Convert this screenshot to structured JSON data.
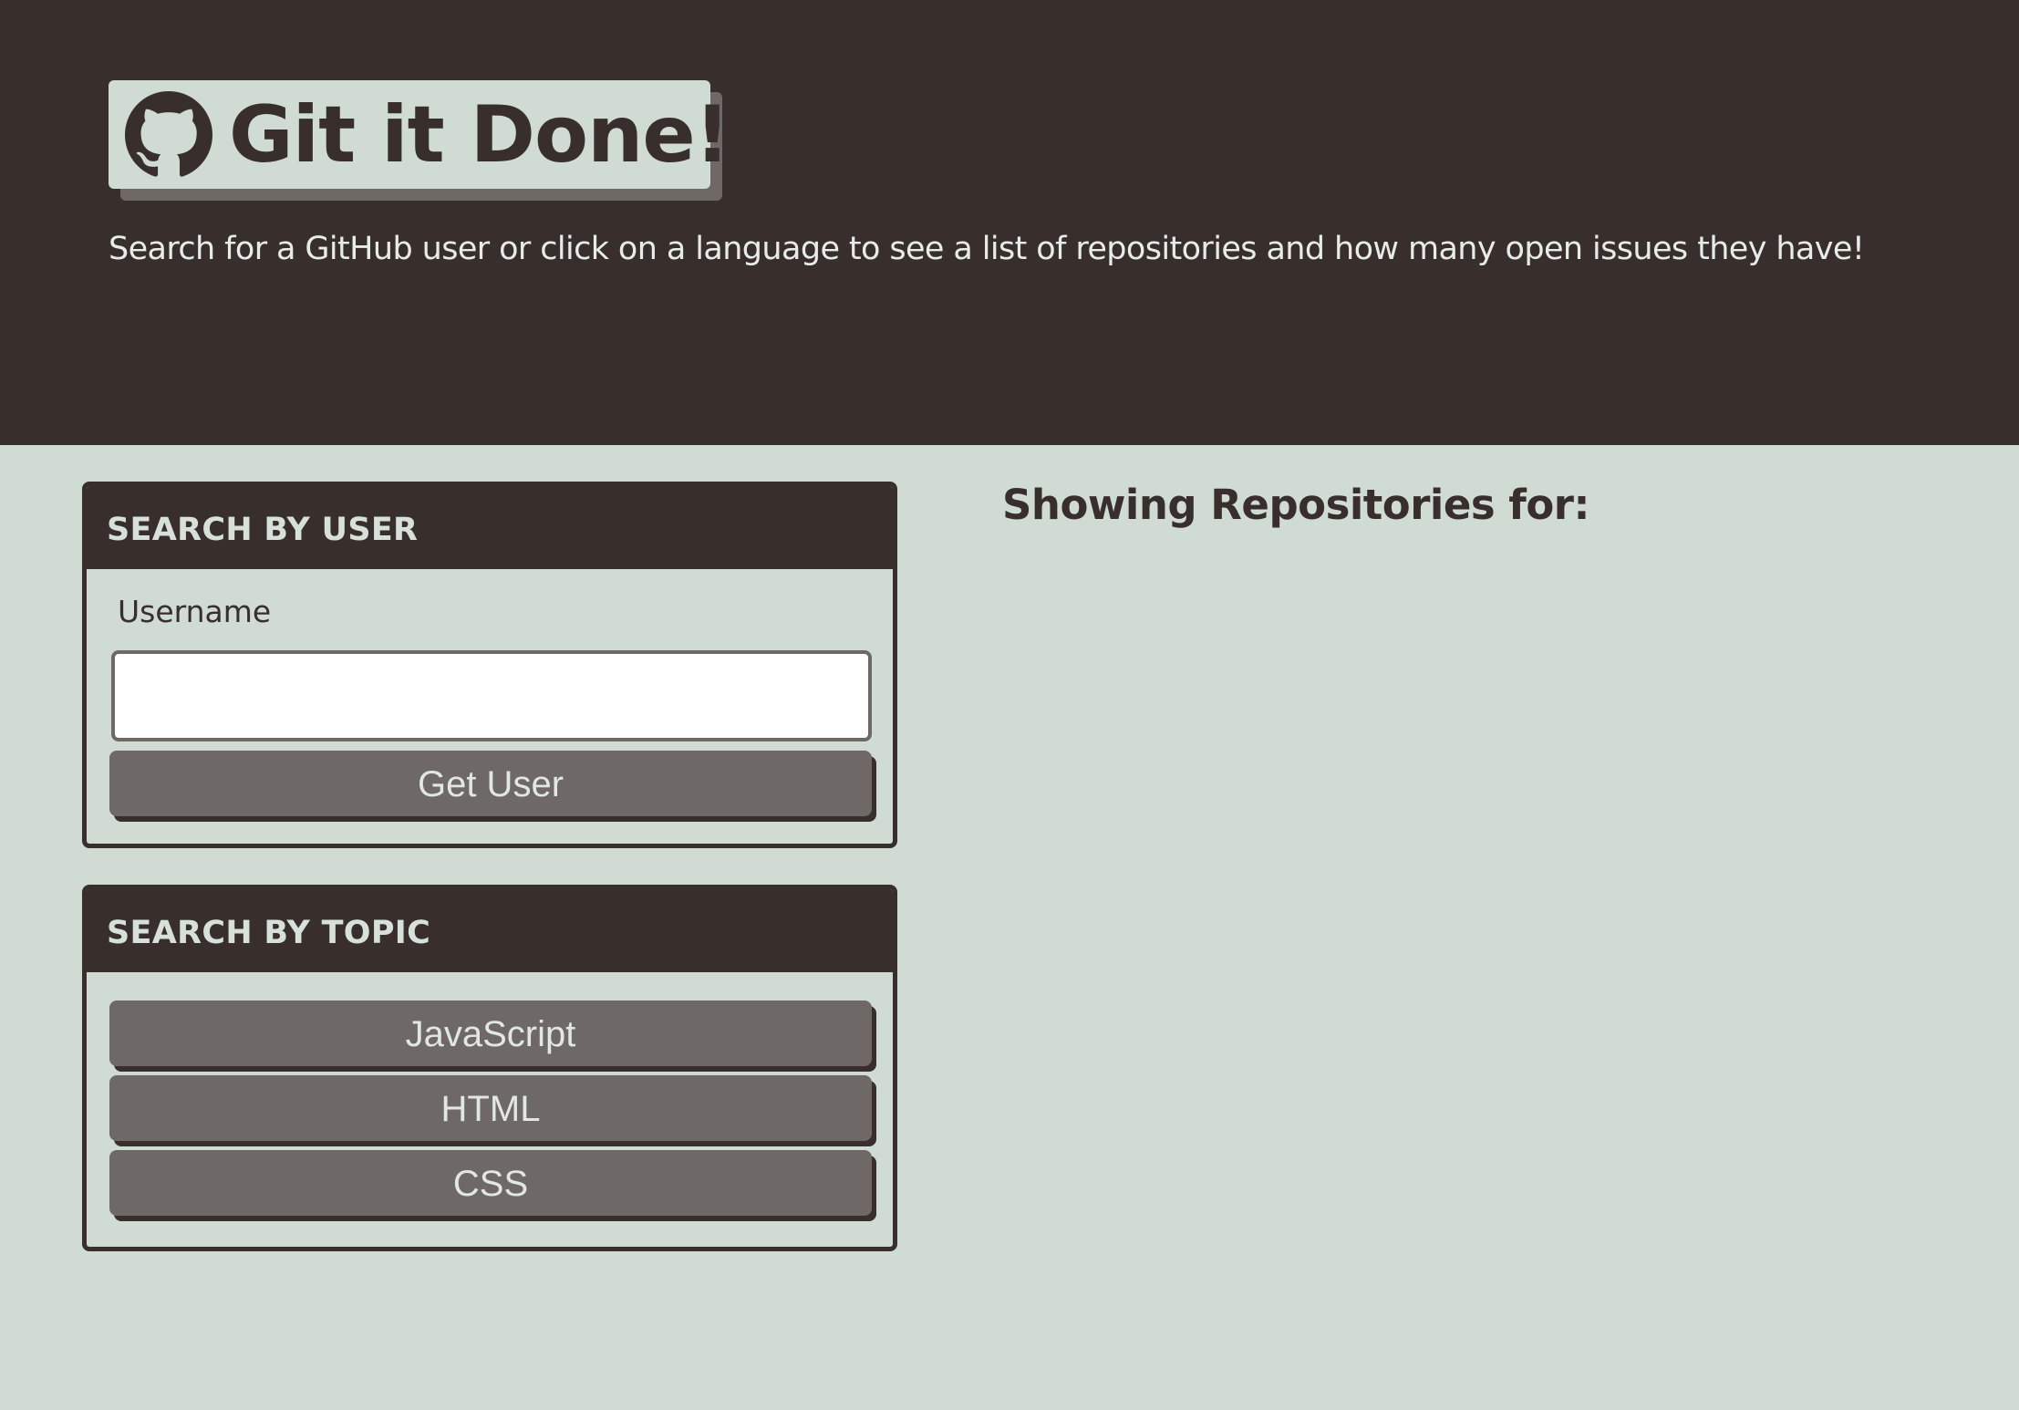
{
  "header": {
    "title": "Git it Done!",
    "subtitle": "Search for a GitHub user or click on a language to see a list of repositories and how many open issues they have!",
    "logo_icon": "github-octocat-icon"
  },
  "user_search": {
    "heading": "SEARCH BY USER",
    "username_label": "Username",
    "username_value": "",
    "username_placeholder": "",
    "button_label": "Get User"
  },
  "topic_search": {
    "heading": "SEARCH BY TOPIC",
    "languages": [
      "JavaScript",
      "HTML",
      "CSS"
    ]
  },
  "repos": {
    "heading": "Showing Repositories for:"
  },
  "colors": {
    "dark": "#382f2d",
    "light": "#d0dbd3",
    "button": "#6e6866"
  }
}
